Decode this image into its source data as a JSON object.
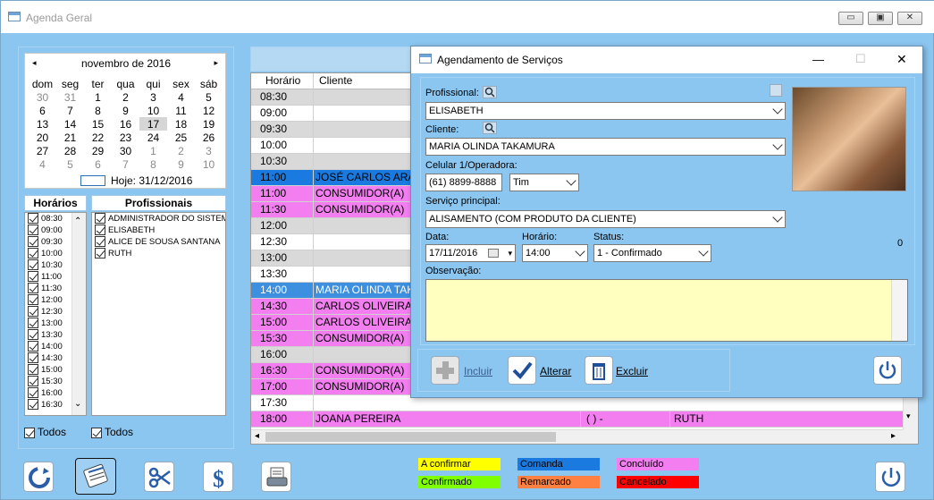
{
  "window": {
    "title": "Agenda Geral",
    "min": "▭",
    "max": "▣",
    "close": "✕"
  },
  "calendar": {
    "month": "novembro de 2016",
    "prev": "◂",
    "next": "▸",
    "weekdays": [
      "dom",
      "seg",
      "ter",
      "qua",
      "qui",
      "sex",
      "sáb"
    ],
    "weeks": [
      [
        "30",
        "31",
        "1",
        "2",
        "3",
        "4",
        "5"
      ],
      [
        "6",
        "7",
        "8",
        "9",
        "10",
        "11",
        "12"
      ],
      [
        "13",
        "14",
        "15",
        "16",
        "17",
        "18",
        "19"
      ],
      [
        "20",
        "21",
        "22",
        "23",
        "24",
        "25",
        "26"
      ],
      [
        "27",
        "28",
        "29",
        "30",
        "1",
        "2",
        "3"
      ],
      [
        "4",
        "5",
        "6",
        "7",
        "8",
        "9",
        "10"
      ]
    ],
    "selected": "17",
    "today_label": "Hoje: 31/12/2016"
  },
  "horarios": {
    "header": "Horários",
    "items": [
      "08:30",
      "09:00",
      "09:30",
      "10:00",
      "10:30",
      "11:00",
      "11:30",
      "12:00",
      "12:30",
      "13:00",
      "13:30",
      "14:00",
      "14:30",
      "15:00",
      "15:30",
      "16:00",
      "16:30"
    ],
    "todos": "Todos"
  },
  "profissionais": {
    "header": "Profissionais",
    "items": [
      "ADMINISTRADOR DO SISTEM",
      "ELISABETH",
      "ALICE DE SOUSA SANTANA",
      "RUTH"
    ],
    "todos": "Todos"
  },
  "grid": {
    "col_horario": "Horário",
    "col_cliente": "Cliente",
    "rows": [
      {
        "h": "08:30",
        "c": "",
        "bg": "#d9d9d9",
        "tc": "#000"
      },
      {
        "h": "09:00",
        "c": "",
        "bg": "#ffffff",
        "tc": "#000"
      },
      {
        "h": "09:30",
        "c": "",
        "bg": "#d9d9d9",
        "tc": "#000"
      },
      {
        "h": "10:00",
        "c": "",
        "bg": "#ffffff",
        "tc": "#000"
      },
      {
        "h": "10:30",
        "c": "",
        "bg": "#d9d9d9",
        "tc": "#000"
      },
      {
        "h": "11:00",
        "c": "JOSÉ CARLOS ARAÚ",
        "bg": "#1a7ae0",
        "tc": "#000"
      },
      {
        "h": "11:00",
        "c": "CONSUMIDOR(A)",
        "bg": "#f27ef0",
        "tc": "#000"
      },
      {
        "h": "11:30",
        "c": "CONSUMIDOR(A)",
        "bg": "#f27ef0",
        "tc": "#000"
      },
      {
        "h": "12:00",
        "c": "",
        "bg": "#d9d9d9",
        "tc": "#000"
      },
      {
        "h": "12:30",
        "c": "",
        "bg": "#ffffff",
        "tc": "#000"
      },
      {
        "h": "13:00",
        "c": "",
        "bg": "#d9d9d9",
        "tc": "#000"
      },
      {
        "h": "13:30",
        "c": "",
        "bg": "#ffffff",
        "tc": "#000"
      },
      {
        "h": "14:00",
        "c": "MARIA OLINDA TAKA",
        "bg": "#3d8fe0",
        "tc": "#fff"
      },
      {
        "h": "14:30",
        "c": "CARLOS OLIVEIRA M",
        "bg": "#f27ef0",
        "tc": "#000"
      },
      {
        "h": "15:00",
        "c": "CARLOS OLIVEIRA M",
        "bg": "#f27ef0",
        "tc": "#000"
      },
      {
        "h": "15:30",
        "c": "CONSUMIDOR(A)",
        "bg": "#f27ef0",
        "tc": "#000"
      },
      {
        "h": "16:00",
        "c": "",
        "bg": "#d9d9d9",
        "tc": "#000"
      },
      {
        "h": "16:30",
        "c": "CONSUMIDOR(A)",
        "bg": "#f27ef0",
        "tc": "#000"
      },
      {
        "h": "17:00",
        "c": "CONSUMIDOR(A)",
        "bg": "#f27ef0",
        "tc": "#000"
      },
      {
        "h": "17:30",
        "c": "",
        "bg": "#ffffff",
        "tc": "#000"
      },
      {
        "h": "18:00",
        "c": "JOANA PEREIRA",
        "bg": "#f27ef0",
        "tc": "#000",
        "tel": "( )    -",
        "prof": "RUTH"
      }
    ]
  },
  "legend": [
    {
      "label": "A confirmar",
      "color": "#ffff00"
    },
    {
      "label": "Comanda",
      "color": "#1a7ae0"
    },
    {
      "label": "Concluído",
      "color": "#f27ef0"
    },
    {
      "label": "Confirmado",
      "color": "#80ff00"
    },
    {
      "label": "Remarcado",
      "color": "#ff8040"
    },
    {
      "label": "Cancelado",
      "color": "#ff0000"
    }
  ],
  "toolbar": {
    "refresh": "refresh-icon",
    "agenda": "agenda-icon",
    "scissors": "scissors-icon",
    "money": "dollar-icon",
    "print": "printer-icon",
    "power": "power-icon"
  },
  "dialog": {
    "title": "Agendamento de Serviços",
    "minimize": "—",
    "maximize": "☐",
    "close": "✕",
    "profissional_label": "Profissional:",
    "profissional_value": "ELISABETH",
    "cliente_label": "Cliente:",
    "cliente_value": "MARIA OLINDA TAKAMURA",
    "celular_label": "Celular 1/Operadora:",
    "celular_value": "(61) 8899-8888",
    "operadora_value": "Tim",
    "servico_label": "Serviço principal:",
    "servico_value": "ALISAMENTO (COM PRODUTO DA CLIENTE)",
    "data_label": "Data:",
    "data_value": "17/11/2016",
    "horario_label": "Horário:",
    "horario_value": "14:00",
    "status_label": "Status:",
    "status_value": "1 - Confirmado",
    "counter": "0",
    "obs_label": "Observação:",
    "obs_value": "",
    "incluir": "Incluir",
    "alterar": "Alterar",
    "excluir": "Excluir"
  }
}
